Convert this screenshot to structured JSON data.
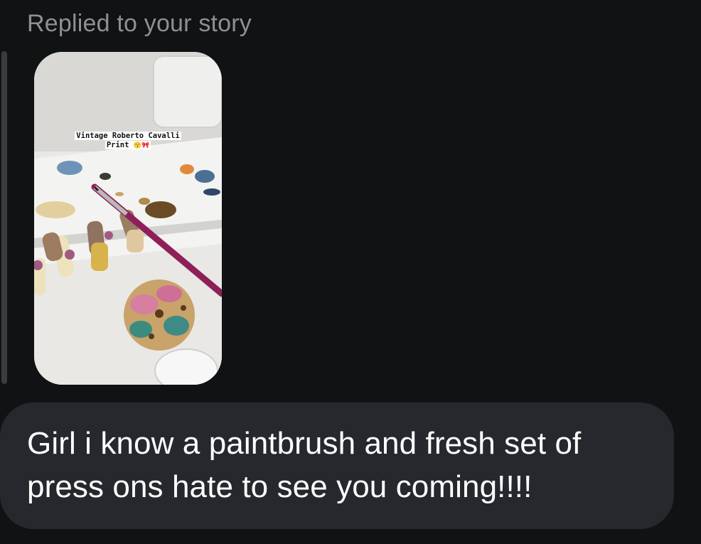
{
  "reply_label": "Replied to your story",
  "story": {
    "sticker_line1": "Vintage Roberto Cavalli",
    "sticker_line2": "Print",
    "sticker_emoji": "😙🎀",
    "image_description_icon": "story-photo-nails-paintbrush"
  },
  "message": {
    "text": "Girl i know a paintbrush and fresh set of press ons hate to see you coming!!!!"
  },
  "colors": {
    "background": "#101214",
    "bubble": "#26282d",
    "label": "#8e9096",
    "text": "#ffffff"
  }
}
